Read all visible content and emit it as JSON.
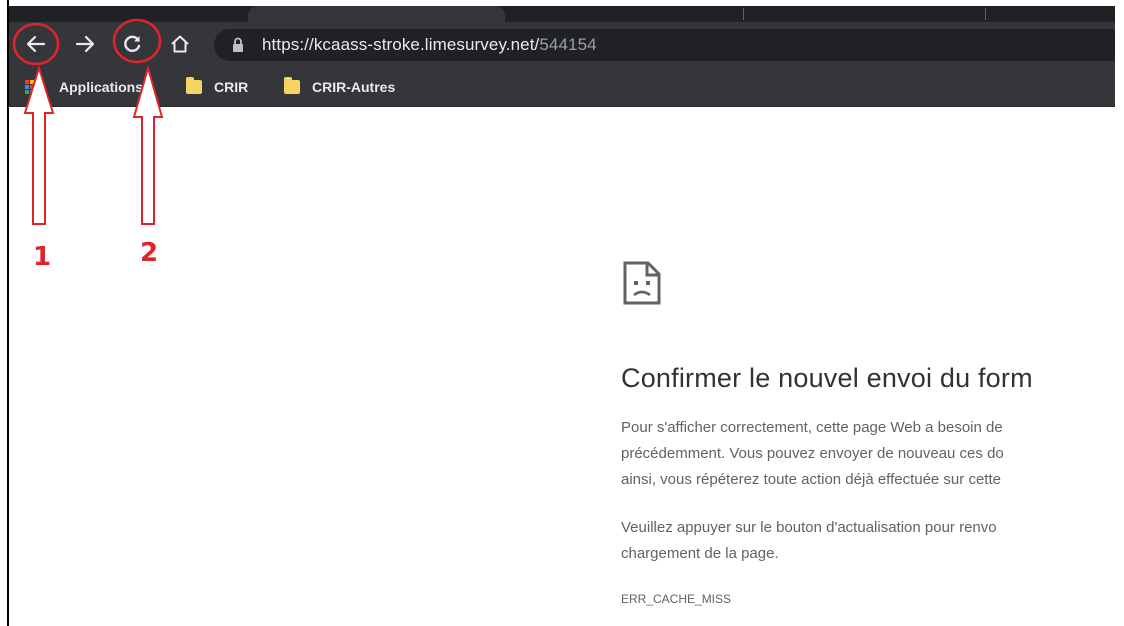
{
  "browser": {
    "url_host": "https://kcaass-stroke.limesurvey.net/",
    "url_path": "544154",
    "bookmarks": [
      "Applications",
      "CRIR",
      "CRIR-Autres"
    ]
  },
  "annotations": {
    "label_1": "1",
    "label_2": "2",
    "color": "#e0242c"
  },
  "error_page": {
    "icon": "sad-document-icon",
    "title": "Confirmer le nouvel envoi du form",
    "para1_line1": "Pour s'afficher correctement, cette page Web a besoin de",
    "para1_line2": "précédemment. Vous pouvez envoyer de nouveau ces do",
    "para1_line3": "ainsi, vous répéterez toute action déjà effectuée sur cette",
    "para2_line1": "Veuillez appuyer sur le bouton d'actualisation pour renvo",
    "para2_line2": "chargement de la page.",
    "error_code": "ERR_CACHE_MISS"
  },
  "colors": {
    "chrome_dark": "#35363a",
    "omnibox": "#202124",
    "folder": "#f6d463"
  }
}
